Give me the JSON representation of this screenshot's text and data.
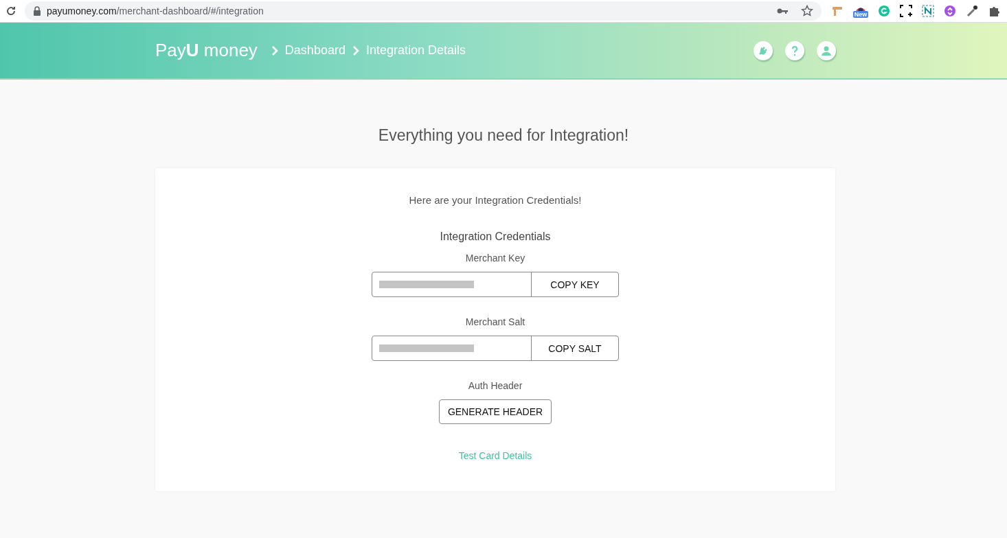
{
  "browser": {
    "url_host": "payumoney.com",
    "url_path": "/merchant-dashboard/#/integration",
    "extension_badge": "New"
  },
  "header": {
    "logo": "Pay**U** money",
    "breadcrumbs": [
      "Dashboard",
      "Integration Details"
    ]
  },
  "page": {
    "title": "Everything you need for Integration!"
  },
  "card": {
    "intro": "Here are your Integration Credentials!",
    "section_title": "Integration Credentials",
    "fields": [
      {
        "label": "Merchant Key",
        "button": "COPY KEY"
      },
      {
        "label": "Merchant Salt",
        "button": "COPY SALT"
      }
    ],
    "auth_label": "Auth Header",
    "auth_button": "GENERATE HEADER",
    "link": "Test Card Details"
  }
}
